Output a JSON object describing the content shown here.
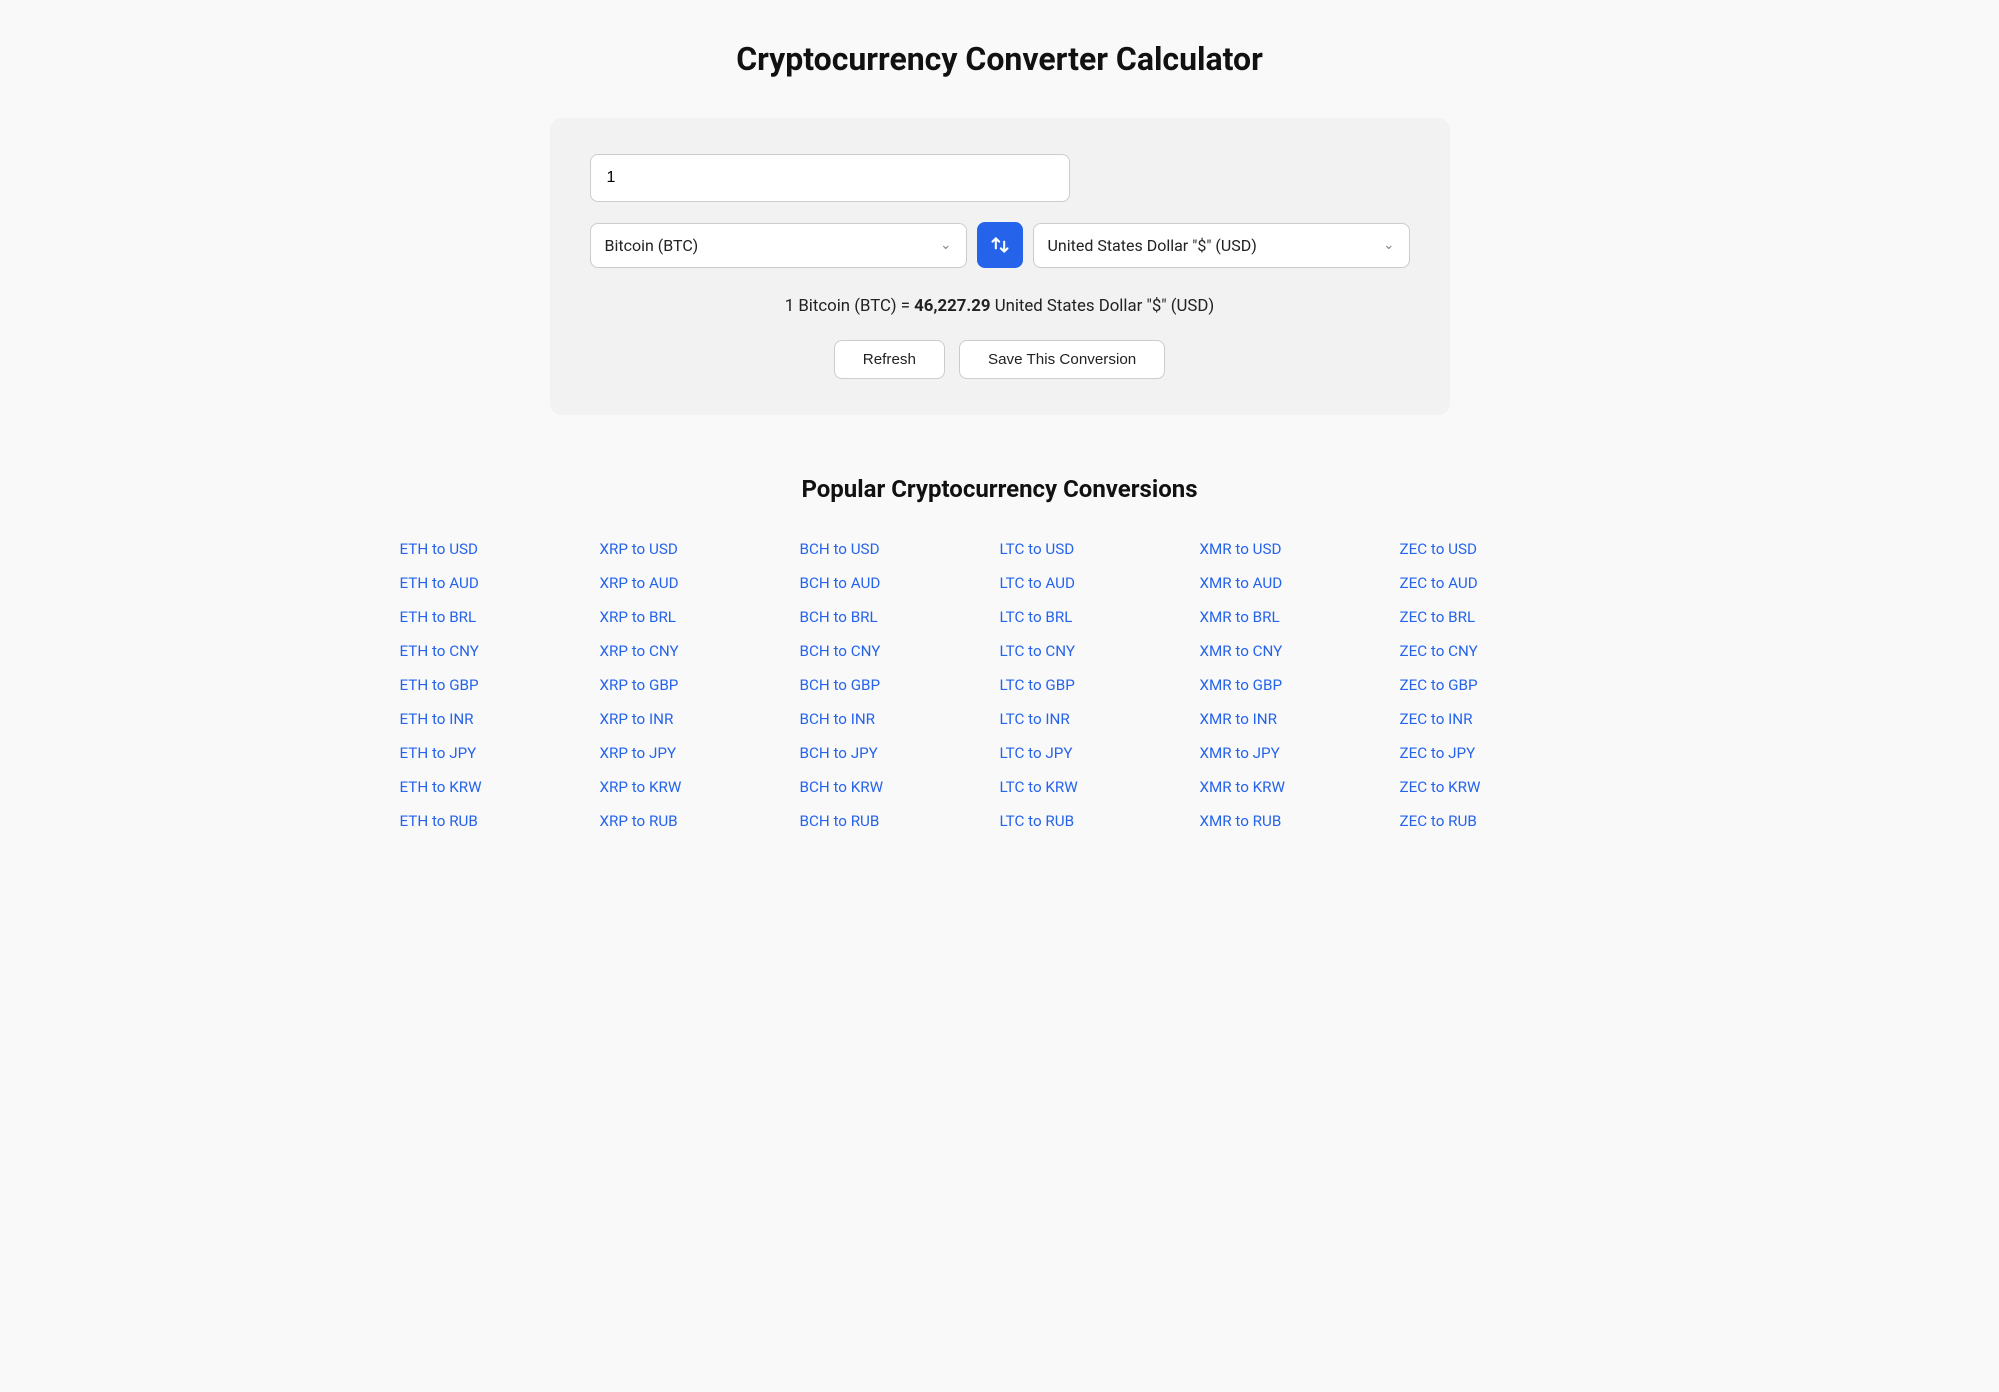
{
  "page": {
    "title": "Cryptocurrency Converter Calculator"
  },
  "converter": {
    "amount_value": "1",
    "from_currency": "Bitcoin (BTC)",
    "to_currency": "United States Dollar \"$\" (USD)",
    "result_text": "1 Bitcoin (BTC)",
    "equals": "=",
    "result_value": "46,227.29",
    "result_unit": "United States Dollar \"$\" (USD)",
    "refresh_label": "Refresh",
    "save_label": "Save This Conversion"
  },
  "popular": {
    "title": "Popular Cryptocurrency Conversions",
    "columns": [
      {
        "items": [
          "ETH to USD",
          "ETH to AUD",
          "ETH to BRL",
          "ETH to CNY",
          "ETH to GBP",
          "ETH to INR",
          "ETH to JPY",
          "ETH to KRW",
          "ETH to RUB"
        ]
      },
      {
        "items": [
          "XRP to USD",
          "XRP to AUD",
          "XRP to BRL",
          "XRP to CNY",
          "XRP to GBP",
          "XRP to INR",
          "XRP to JPY",
          "XRP to KRW",
          "XRP to RUB"
        ]
      },
      {
        "items": [
          "BCH to USD",
          "BCH to AUD",
          "BCH to BRL",
          "BCH to CNY",
          "BCH to GBP",
          "BCH to INR",
          "BCH to JPY",
          "BCH to KRW",
          "BCH to RUB"
        ]
      },
      {
        "items": [
          "LTC to USD",
          "LTC to AUD",
          "LTC to BRL",
          "LTC to CNY",
          "LTC to GBP",
          "LTC to INR",
          "LTC to JPY",
          "LTC to KRW",
          "LTC to RUB"
        ]
      },
      {
        "items": [
          "XMR to USD",
          "XMR to AUD",
          "XMR to BRL",
          "XMR to CNY",
          "XMR to GBP",
          "XMR to INR",
          "XMR to JPY",
          "XMR to KRW",
          "XMR to RUB"
        ]
      },
      {
        "items": [
          "ZEC to USD",
          "ZEC to AUD",
          "ZEC to BRL",
          "ZEC to CNY",
          "ZEC to GBP",
          "ZEC to INR",
          "ZEC to JPY",
          "ZEC to KRW",
          "ZEC to RUB"
        ]
      }
    ]
  }
}
